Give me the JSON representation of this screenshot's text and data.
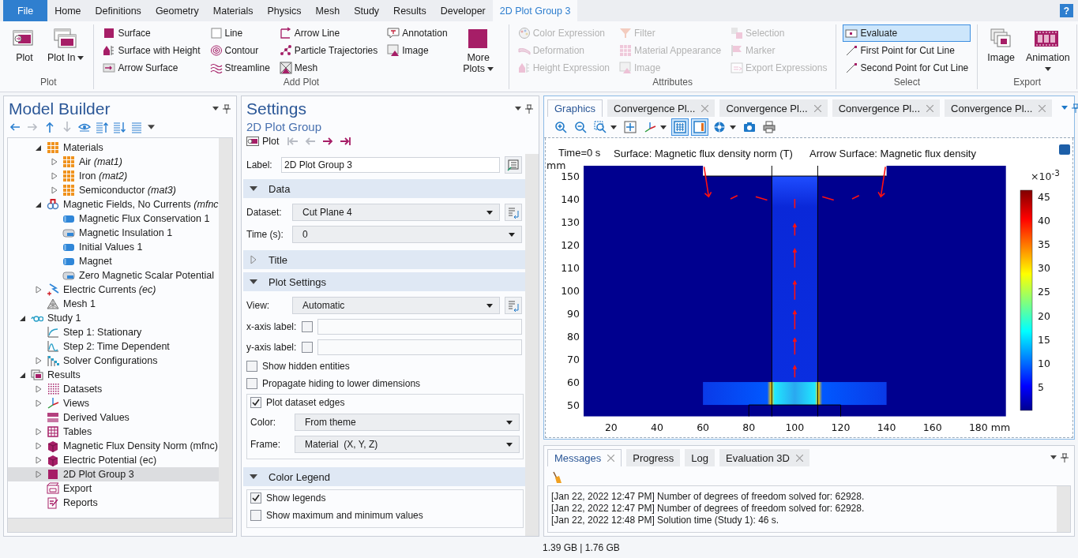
{
  "ribbon": {
    "tabs": [
      {
        "label": "File",
        "kind": "file",
        "selected": false
      },
      {
        "label": "Home",
        "kind": "tab",
        "selected": false
      },
      {
        "label": "Definitions",
        "kind": "tab",
        "selected": false
      },
      {
        "label": "Geometry",
        "kind": "tab",
        "selected": false
      },
      {
        "label": "Materials",
        "kind": "tab",
        "selected": false
      },
      {
        "label": "Physics",
        "kind": "tab",
        "selected": false
      },
      {
        "label": "Mesh",
        "kind": "tab",
        "selected": false
      },
      {
        "label": "Study",
        "kind": "tab",
        "selected": false
      },
      {
        "label": "Results",
        "kind": "tab",
        "selected": false
      },
      {
        "label": "Developer",
        "kind": "tab",
        "selected": false
      },
      {
        "label": "2D Plot Group 3",
        "kind": "context",
        "selected": true
      }
    ],
    "help": "?",
    "groups": [
      {
        "title": "Plot",
        "blocks": [
          {
            "kind": "large",
            "label": "Plot",
            "dropdown": false
          },
          {
            "kind": "large",
            "label": "Plot In",
            "dropdown": true
          }
        ]
      },
      {
        "title": "Add Plot",
        "blocks": [
          {
            "kind": "column",
            "items": [
              {
                "label": "Surface",
                "disabled": false
              },
              {
                "label": "Surface with Height",
                "disabled": false
              },
              {
                "label": "Arrow Surface",
                "disabled": false
              }
            ]
          },
          {
            "kind": "column",
            "items": [
              {
                "label": "Line",
                "disabled": false
              },
              {
                "label": "Contour",
                "disabled": false
              },
              {
                "label": "Streamline",
                "disabled": false
              }
            ]
          },
          {
            "kind": "column",
            "items": [
              {
                "label": "Arrow Line",
                "disabled": false
              },
              {
                "label": "Particle Trajectories",
                "disabled": false
              },
              {
                "label": "Mesh",
                "disabled": false
              }
            ]
          },
          {
            "kind": "column",
            "items": [
              {
                "label": "Annotation",
                "disabled": false
              },
              {
                "label": "Image",
                "disabled": false
              }
            ]
          },
          {
            "kind": "large",
            "label": "More Plots",
            "dropdown": true
          }
        ]
      },
      {
        "title": "Attributes",
        "blocks": [
          {
            "kind": "column",
            "items": [
              {
                "label": "Color Expression",
                "disabled": true
              },
              {
                "label": "Deformation",
                "disabled": true
              },
              {
                "label": "Height Expression",
                "disabled": true
              }
            ]
          },
          {
            "kind": "column",
            "items": [
              {
                "label": "Filter",
                "disabled": true
              },
              {
                "label": "Material Appearance",
                "disabled": true
              },
              {
                "label": "Image",
                "disabled": true
              }
            ]
          },
          {
            "kind": "column",
            "items": [
              {
                "label": "Selection",
                "disabled": true
              },
              {
                "label": "Marker",
                "disabled": true
              },
              {
                "label": "Export Expressions",
                "disabled": true
              }
            ]
          }
        ]
      },
      {
        "title": "Select",
        "blocks": [
          {
            "kind": "column",
            "items": [
              {
                "label": "Evaluate",
                "selected": true
              },
              {
                "label": "First Point for Cut Line",
                "selected": false
              },
              {
                "label": "Second Point for Cut Line",
                "selected": false
              }
            ]
          }
        ]
      },
      {
        "title": "Export",
        "blocks": [
          {
            "kind": "large",
            "label": "Image",
            "dropdown": false
          },
          {
            "kind": "large",
            "label": "Animation",
            "dropdown": true
          }
        ]
      }
    ]
  },
  "model_builder": {
    "title": "Model Builder",
    "toolbar": [
      {
        "kind": "back",
        "disabled": false
      },
      {
        "kind": "forward",
        "disabled": true
      },
      {
        "kind": "up",
        "disabled": false
      },
      {
        "kind": "down",
        "disabled": true
      },
      {
        "kind": "show",
        "disabled": false
      },
      {
        "kind": "sort-up",
        "disabled": false
      },
      {
        "kind": "sort-down",
        "disabled": false
      },
      {
        "kind": "list",
        "disabled": false
      }
    ]
  },
  "tree": {
    "items": [
      {
        "children": [
          {
            "label": "Materials",
            "kind": "materials",
            "expanded": true,
            "selected": false,
            "children": [
              {
                "label": "Air *(mat1)*",
                "kind": "materials",
                "expanded": false,
                "selected": false
              },
              {
                "label": "Iron *(mat2)*",
                "kind": "materials",
                "expanded": false,
                "selected": false
              },
              {
                "label": "Semiconductor *(mat3)*",
                "kind": "materials",
                "expanded": false,
                "selected": false
              }
            ]
          },
          {
            "label": "Magnetic Fields, No Currents *(mfnc*",
            "kind": "physics",
            "expanded": true,
            "selected": false,
            "children": [
              {
                "label": "Magnetic Flux Conservation 1",
                "kind": "feature",
                "selected": false
              },
              {
                "label": "Magnetic Insulation 1",
                "kind": "feature-grey",
                "selected": false
              },
              {
                "label": "Initial Values 1",
                "kind": "feature",
                "selected": false
              },
              {
                "label": "Magnet",
                "kind": "feature",
                "selected": false
              },
              {
                "label": "Zero Magnetic Scalar Potential",
                "kind": "feature-grey",
                "selected": false
              }
            ]
          },
          {
            "label": "Electric Currents *(ec)*",
            "kind": "electric",
            "expanded": false,
            "selected": false
          },
          {
            "label": "Mesh 1",
            "kind": "mesh",
            "selected": false
          }
        ]
      },
      {
        "label": "Study 1",
        "kind": "study",
        "expanded": true,
        "selected": false,
        "children": [
          {
            "label": "Step 1: Stationary",
            "kind": "step",
            "selected": false
          },
          {
            "label": "Step 2: Time Dependent",
            "kind": "step-time",
            "selected": false
          },
          {
            "label": "Solver Configurations",
            "kind": "solver",
            "expanded": false,
            "selected": false
          }
        ]
      },
      {
        "label": "Results",
        "kind": "results",
        "expanded": true,
        "selected": false,
        "children": [
          {
            "label": "Datasets",
            "kind": "datasets",
            "expanded": false,
            "selected": false
          },
          {
            "label": "Views",
            "kind": "views",
            "expanded": false,
            "selected": false
          },
          {
            "label": "Derived Values",
            "kind": "derived",
            "selected": false
          },
          {
            "label": "Tables",
            "kind": "tables",
            "expanded": false,
            "selected": false
          },
          {
            "label": "Magnetic Flux Density Norm (mfnc)",
            "kind": "plot3d",
            "expanded": false,
            "selected": false
          },
          {
            "label": "Electric Potential (ec)",
            "kind": "plot3d",
            "expanded": false,
            "selected": false
          },
          {
            "label": "2D Plot Group 3",
            "kind": "plot2d",
            "expanded": false,
            "selected": true
          },
          {
            "label": "Export",
            "kind": "export",
            "selected": false
          },
          {
            "label": "Reports",
            "kind": "reports",
            "selected": false
          }
        ]
      }
    ]
  },
  "settings": {
    "title": "Settings",
    "subtitle": "2D Plot Group",
    "plot_button": "Plot",
    "navigation": [
      {
        "kind": "first",
        "disabled": true
      },
      {
        "kind": "previous",
        "disabled": true
      },
      {
        "kind": "next",
        "disabled": false
      },
      {
        "kind": "last",
        "disabled": false
      }
    ],
    "label_field": {
      "label": "Label:",
      "value": "2D Plot Group 3"
    },
    "sections": [
      {
        "title": "Data",
        "expanded": true,
        "rows": [
          {
            "kind": "select",
            "label": "Dataset:",
            "value": "Cut Plane 4",
            "side_button": true
          },
          {
            "kind": "select",
            "label": "Time (s):",
            "value": "0",
            "side_button": false
          }
        ]
      },
      {
        "title": "Title",
        "expanded": false
      },
      {
        "title": "Plot Settings",
        "expanded": true,
        "rows": [
          {
            "kind": "select",
            "label": "View:",
            "value": "Automatic",
            "side_button": true
          },
          {
            "kind": "axis-label",
            "label": "x-axis label:",
            "checked": false
          },
          {
            "kind": "axis-label",
            "label": "y-axis label:",
            "checked": false
          },
          {
            "kind": "checkbox",
            "label": "Show hidden entities",
            "checked": false
          },
          {
            "kind": "checkbox",
            "label": "Propagate hiding to lower dimensions",
            "checked": false
          },
          {
            "kind": "group",
            "label": "Plot dataset edges",
            "checked": true,
            "rows": [
              {
                "kind": "select",
                "label": "Color:",
                "value": "From theme",
                "side_button": false
              },
              {
                "kind": "select",
                "label": "Frame:",
                "value": "Material  (X, Y, Z)",
                "side_button": false
              }
            ]
          }
        ]
      },
      {
        "title": "Color Legend",
        "expanded": true,
        "rows": [
          {
            "kind": "group",
            "label": "Show legends",
            "checked": true,
            "rows": [
              {
                "kind": "checkbox",
                "label": "Show maximum and minimum values",
                "checked": false
              }
            ]
          }
        ]
      }
    ]
  },
  "graphics": {
    "tabs": [
      {
        "label": "Graphics",
        "selected": true,
        "closable": false
      },
      {
        "label": "Convergence Pl...",
        "selected": false,
        "closable": true
      },
      {
        "label": "Convergence Pl...",
        "selected": false,
        "closable": true
      },
      {
        "label": "Convergence Pl...",
        "selected": false,
        "closable": true
      },
      {
        "label": "Convergence Pl...",
        "selected": false,
        "closable": true
      }
    ],
    "toolbar": [
      {
        "kind": "zoom-in",
        "selected": false,
        "dropdown": false
      },
      {
        "kind": "zoom-out",
        "selected": false,
        "dropdown": false
      },
      {
        "kind": "zoom-box",
        "selected": false,
        "dropdown": true
      },
      {
        "kind": "zoom-extents",
        "selected": false,
        "dropdown": false
      },
      {
        "kind": "axes",
        "selected": false,
        "dropdown": true
      },
      {
        "kind": "grid",
        "selected": true,
        "dropdown": false
      },
      {
        "kind": "legend",
        "selected": true,
        "dropdown": false
      },
      {
        "kind": "light",
        "selected": false,
        "dropdown": true
      },
      {
        "kind": "camera",
        "selected": false,
        "dropdown": false
      },
      {
        "kind": "print",
        "selected": false,
        "dropdown": false
      }
    ],
    "plot": {
      "time": "Time=0 s",
      "title": "Surface: Magnetic flux density norm (T)",
      "subtitle": "Arrow Surface: Magnetic flux density",
      "y_unit": "mm",
      "x_unit": "mm",
      "x_ticks": [
        "20",
        "40",
        "60",
        "80",
        "100",
        "120",
        "140",
        "160",
        "180"
      ],
      "y_ticks": [
        "150",
        "140",
        "130",
        "120",
        "110",
        "100",
        "90",
        "80",
        "70",
        "60",
        "50"
      ],
      "legend_scale": "×10$^{-3}$",
      "legend_ticks": [
        "45",
        "40",
        "35",
        "30",
        "25",
        "20",
        "15",
        "10",
        "5"
      ]
    }
  },
  "messages": {
    "tabs": [
      {
        "label": "Messages",
        "selected": true,
        "closable": true
      },
      {
        "label": "Progress",
        "selected": false,
        "closable": false
      },
      {
        "label": "Log",
        "selected": false,
        "closable": false
      },
      {
        "label": "Evaluation 3D",
        "selected": false,
        "closable": true
      }
    ],
    "lines": [
      "[Jan 22, 2022 12:47 PM] Number of degrees of freedom solved for: 62928.",
      "[Jan 22, 2022 12:47 PM] Number of degrees of freedom solved for: 62928.",
      "[Jan 22, 2022 12:48 PM] Solution time (Study 1): 46 s."
    ]
  },
  "status_bar": {
    "memory": "1.39 GB | 1.76 GB"
  }
}
